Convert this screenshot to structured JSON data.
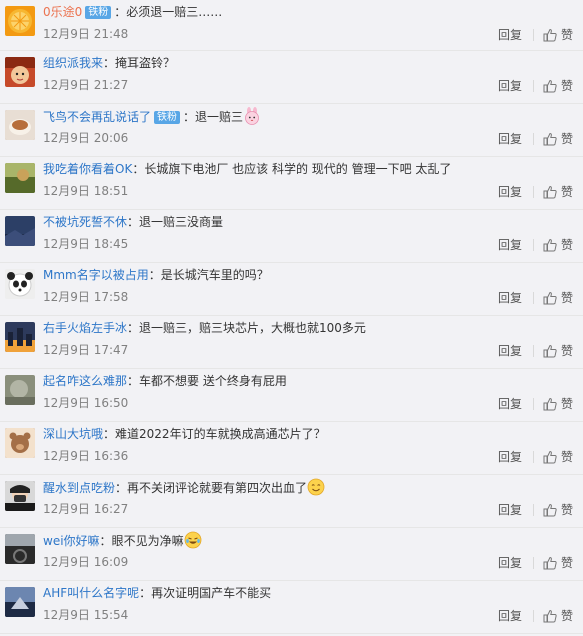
{
  "ui": {
    "reply_label": "回复",
    "like_label": "赞",
    "badge_label": "铁粉",
    "separator": "："
  },
  "comments": [
    {
      "user": "0乐途0",
      "badge": true,
      "text": "必须退一赔三……",
      "emoji": null,
      "time": "12月9日 21:48",
      "avatar": "orange-fruit-avatar",
      "avatar_color": "#f39a12"
    },
    {
      "user": "组织派我来",
      "badge": false,
      "text": "掩耳盗铃？",
      "emoji": null,
      "time": "12月9日 21:27",
      "avatar": "cartoon-face-avatar",
      "avatar_color": "#c64a2a"
    },
    {
      "user": "飞鸟不会再乱说话了",
      "badge": true,
      "text": "退一赔三",
      "emoji": "pink-bunny-emoji",
      "time": "12月9日 20:06",
      "avatar": "food-bowl-avatar",
      "avatar_color": "#b79a86"
    },
    {
      "user": "我吃着你看着OK",
      "badge": false,
      "text": "长城旗下电池厂 也应该 科学的 现代的 管理一下吧  太乱了",
      "emoji": null,
      "time": "12月9日 18:51",
      "avatar": "landscape-avatar",
      "avatar_color": "#6c7b3a"
    },
    {
      "user": "不被坑死誓不休",
      "badge": false,
      "text": "退一赔三没商量",
      "emoji": null,
      "time": "12月9日 18:45",
      "avatar": "dark-sky-avatar",
      "avatar_color": "#2c3f66"
    },
    {
      "user": "Mmm名字以被占用",
      "badge": false,
      "text": "是长城汽车里的吗？",
      "emoji": null,
      "time": "12月9日 17:58",
      "avatar": "panda-avatar",
      "avatar_color": "#eeeeee"
    },
    {
      "user": "右手火焰左手冰",
      "badge": false,
      "text": "退一赔三，赔三块芯片，大概也就100多元",
      "emoji": null,
      "time": "12月9日 17:47",
      "avatar": "night-city-avatar",
      "avatar_color": "#2d3a5c"
    },
    {
      "user": "起名咋这么难那",
      "badge": false,
      "text": "车都不想要 送个终身有屁用",
      "emoji": null,
      "time": "12月9日 16:50",
      "avatar": "gray-photo-avatar",
      "avatar_color": "#8a8f7c"
    },
    {
      "user": "深山大坑哦",
      "badge": false,
      "text": "难道2022年订的车就换成高通芯片了？",
      "emoji": null,
      "time": "12月9日 16:36",
      "avatar": "teddy-bear-avatar",
      "avatar_color": "#9a6a4a"
    },
    {
      "user": "醒水到点吃粉",
      "badge": false,
      "text": "再不关闭评论就要有第四次出血了",
      "emoji": "smile-emoji",
      "time": "12月9日 16:27",
      "avatar": "masked-person-avatar",
      "avatar_color": "#2a2a2a"
    },
    {
      "user": "wei你好嘛",
      "badge": false,
      "text": "眼不见为净嘛",
      "emoji": "laugh-cry-emoji",
      "time": "12月9日 16:09",
      "avatar": "car-interior-avatar",
      "avatar_color": "#4a4a4a"
    },
    {
      "user": "AHF叫什么名字呢",
      "badge": false,
      "text": "再次证明国产车不能买",
      "emoji": null,
      "time": "12月9日 15:54",
      "avatar": "blue-dark-avatar",
      "avatar_color": "#3a4a6a"
    }
  ]
}
